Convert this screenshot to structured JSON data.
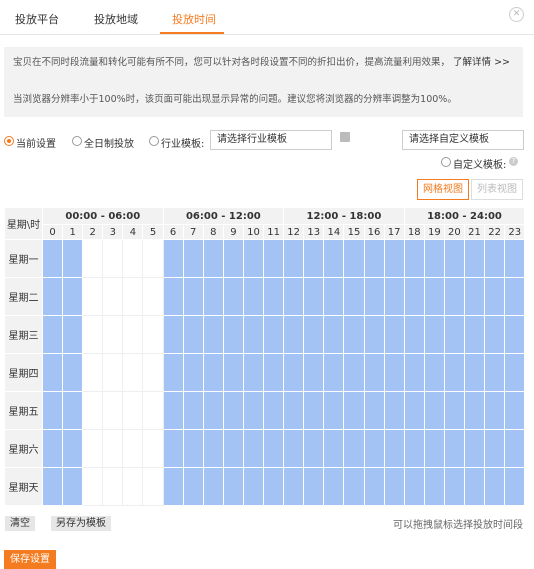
{
  "tabs": [
    {
      "label": "投放平台",
      "active": false
    },
    {
      "label": "投放地域",
      "active": false
    },
    {
      "label": "投放时间",
      "active": true
    }
  ],
  "info": {
    "line1": "宝贝在不同时段流量和转化可能有所不同，您可以针对各时段设置不同的折扣出价，提高流量利用效果，",
    "link": "了解详情 >>",
    "line2": "当浏览器分辨率小于100%时，该页面可能出现显示异常的问题。建议您将浏览器的分辨率调整为100%。"
  },
  "options": {
    "current": "当前设置",
    "allday": "全日制投放",
    "industry": "行业模板:",
    "industry_placeholder": "请选择行业模板",
    "custom_placeholder": "请选择自定义模板",
    "custom_label": "自定义模板:"
  },
  "views": {
    "grid": "网格视图",
    "list": "列表视图"
  },
  "table": {
    "corner": "星期\\时",
    "ranges": [
      "00:00 - 06:00",
      "06:00 - 12:00",
      "12:00 - 18:00",
      "18:00 - 24:00"
    ],
    "hours": [
      "0",
      "1",
      "2",
      "3",
      "4",
      "5",
      "6",
      "7",
      "8",
      "9",
      "10",
      "11",
      "12",
      "13",
      "14",
      "15",
      "16",
      "17",
      "18",
      "19",
      "20",
      "21",
      "22",
      "23"
    ],
    "days": [
      "星期一",
      "星期二",
      "星期三",
      "星期四",
      "星期五",
      "星期六",
      "星期天"
    ],
    "active_hours": [
      0,
      1,
      6,
      7,
      8,
      9,
      10,
      11,
      12,
      13,
      14,
      15,
      16,
      17,
      18,
      19,
      20,
      21,
      22,
      23
    ]
  },
  "buttons": {
    "clear": "清空",
    "save_template": "另存为模板",
    "save": "保存设置"
  },
  "hint": "可以拖拽鼠标选择投放时间段",
  "colors": {
    "accent": "#f47b20",
    "active_cell": "#a3c3f5"
  }
}
